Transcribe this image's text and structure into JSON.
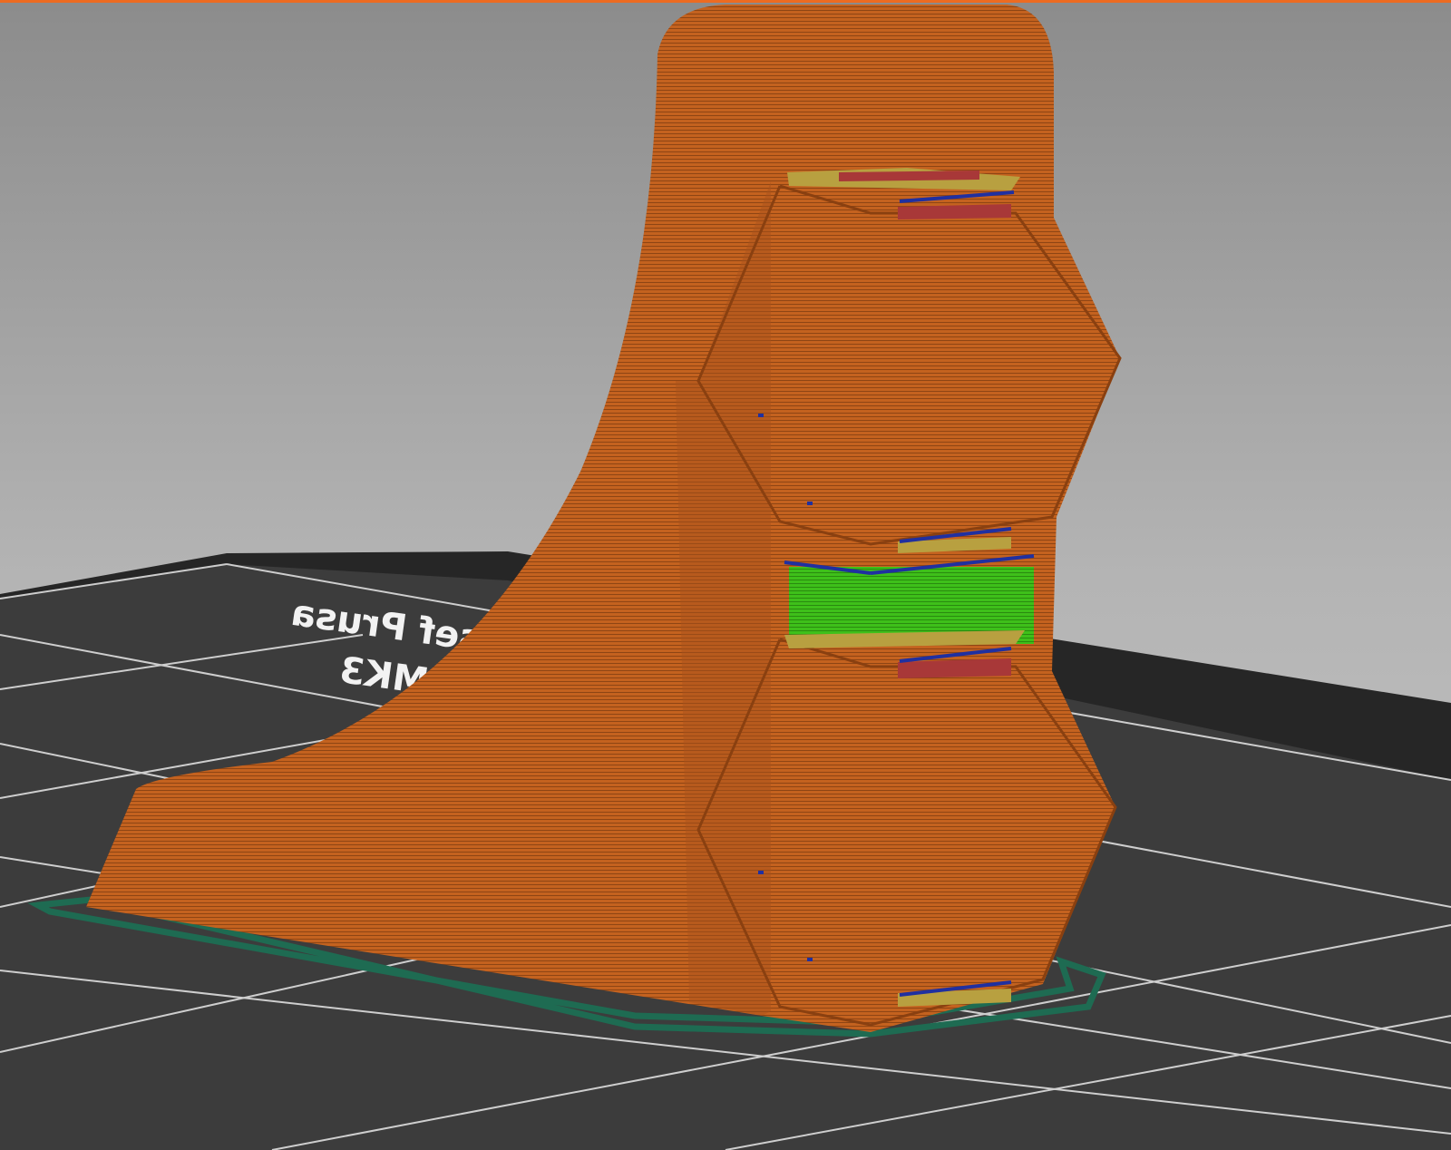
{
  "app": {
    "view": "3D preview"
  },
  "bed": {
    "logo_line1": "A i3 MK3",
    "logo_line2": "sef Prusa"
  },
  "colors": {
    "accent": "#ed6b21",
    "perimeter": "#c2601f",
    "support": "#3ec01a",
    "solid_infill": "#a83838",
    "top_infill": "#b8a040",
    "bridge": "#2030a0",
    "skirt": "#1e6b52",
    "bed": "#3a3a3a"
  }
}
